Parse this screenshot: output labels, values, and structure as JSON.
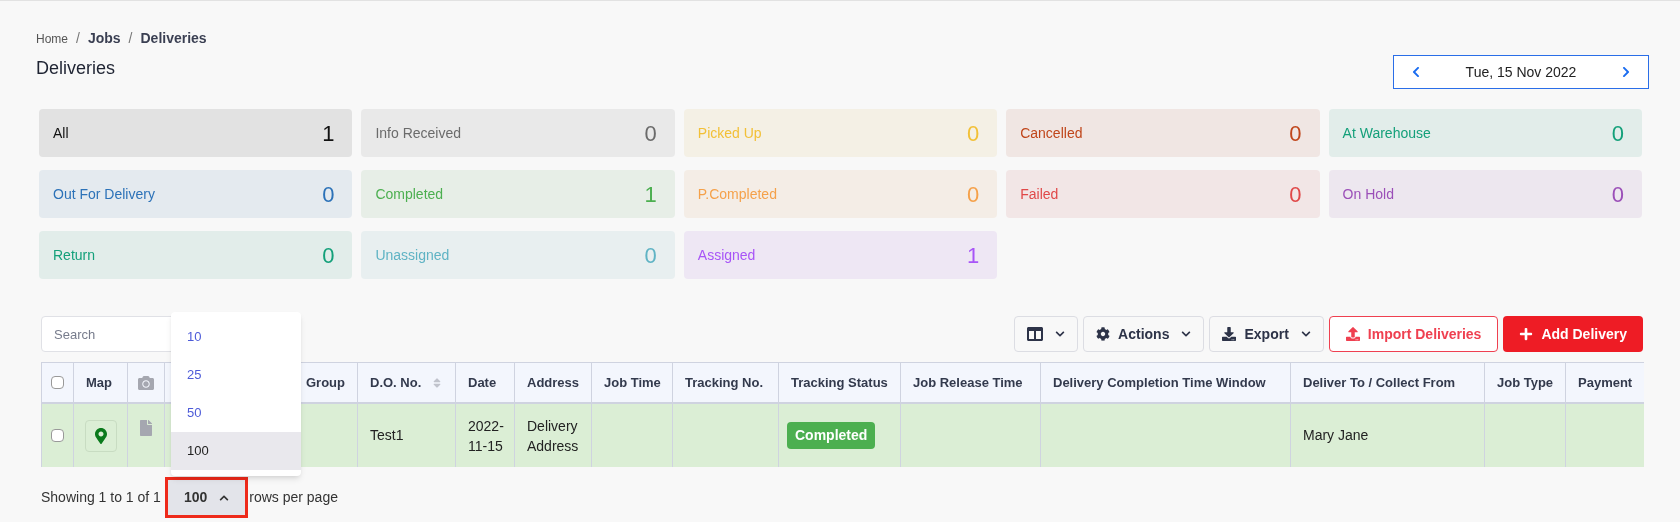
{
  "breadcrumb": [
    {
      "label": "Home",
      "current": false
    },
    {
      "label": "Jobs",
      "current": true,
      "separator": "/"
    },
    {
      "label": "Deliveries",
      "current": true,
      "separator": "/"
    }
  ],
  "page_title": "Deliveries",
  "date_picker": {
    "value": "Tue, 15 Nov 2022"
  },
  "status_cards": [
    {
      "label": "All",
      "count": "1",
      "color": "#111111"
    },
    {
      "label": "Info Received",
      "count": "0",
      "color": "#6b6b6b"
    },
    {
      "label": "Picked Up",
      "count": "0",
      "color": "#f2c037"
    },
    {
      "label": "Cancelled",
      "count": "0",
      "color": "#c0461b"
    },
    {
      "label": "At Warehouse",
      "count": "0",
      "color": "#14a07a"
    },
    {
      "label": "Out For Delivery",
      "count": "0",
      "color": "#2c72b8"
    },
    {
      "label": "Completed",
      "count": "1",
      "color": "#4caf50"
    },
    {
      "label": "P.Completed",
      "count": "0",
      "color": "#f5a14a"
    },
    {
      "label": "Failed",
      "count": "0",
      "color": "#e04848"
    },
    {
      "label": "On Hold",
      "count": "0",
      "color": "#9b4fb8"
    },
    {
      "label": "Return",
      "count": "0",
      "color": "#14a07a"
    },
    {
      "label": "Unassigned",
      "count": "0",
      "color": "#5fb3c4"
    },
    {
      "label": "Assigned",
      "count": "1",
      "color": "#a855f7"
    }
  ],
  "search": {
    "placeholder": "Search"
  },
  "toolbar": [
    {
      "kind": "columns"
    },
    {
      "kind": "menu",
      "label": "Actions"
    },
    {
      "kind": "menu",
      "label": "Export"
    },
    {
      "kind": "outline",
      "label": "Import Deliveries"
    },
    {
      "kind": "primary",
      "label": "Add Delivery"
    }
  ],
  "table": {
    "columns": [
      {
        "kind": "checkbox",
        "checked": false
      },
      {
        "kind": "text",
        "label": "Map"
      },
      {
        "kind": "camera"
      },
      {
        "kind": "text",
        "label": "Group"
      },
      {
        "kind": "sort",
        "label": "D.O. No."
      },
      {
        "kind": "text",
        "label": "Date"
      },
      {
        "kind": "text",
        "label": "Address"
      },
      {
        "kind": "text",
        "label": "Job Time"
      },
      {
        "kind": "text",
        "label": "Tracking No."
      },
      {
        "kind": "text",
        "label": "Tracking Status"
      },
      {
        "kind": "text",
        "label": "Job Release Time"
      },
      {
        "kind": "text",
        "label": "Delivery Completion Time Window"
      },
      {
        "kind": "text",
        "label": "Deliver To / Collect From"
      },
      {
        "kind": "text",
        "label": "Job Type"
      },
      {
        "kind": "text",
        "label": "Payment"
      }
    ],
    "rows": [
      {
        "checked": false,
        "do_no": "Test1",
        "date": "2022-11-15",
        "address": "Delivery Address",
        "tracking_status": "Completed",
        "deliver_to": "Mary Jane"
      }
    ]
  },
  "page_size_menu": [
    {
      "label": "10",
      "selected": false
    },
    {
      "label": "25",
      "selected": false
    },
    {
      "label": "50",
      "selected": false
    },
    {
      "label": "100",
      "selected": true
    }
  ],
  "footer": {
    "showing": "Showing 1 to 1 of 1",
    "page_size": "100",
    "suffix": "rows per page"
  }
}
